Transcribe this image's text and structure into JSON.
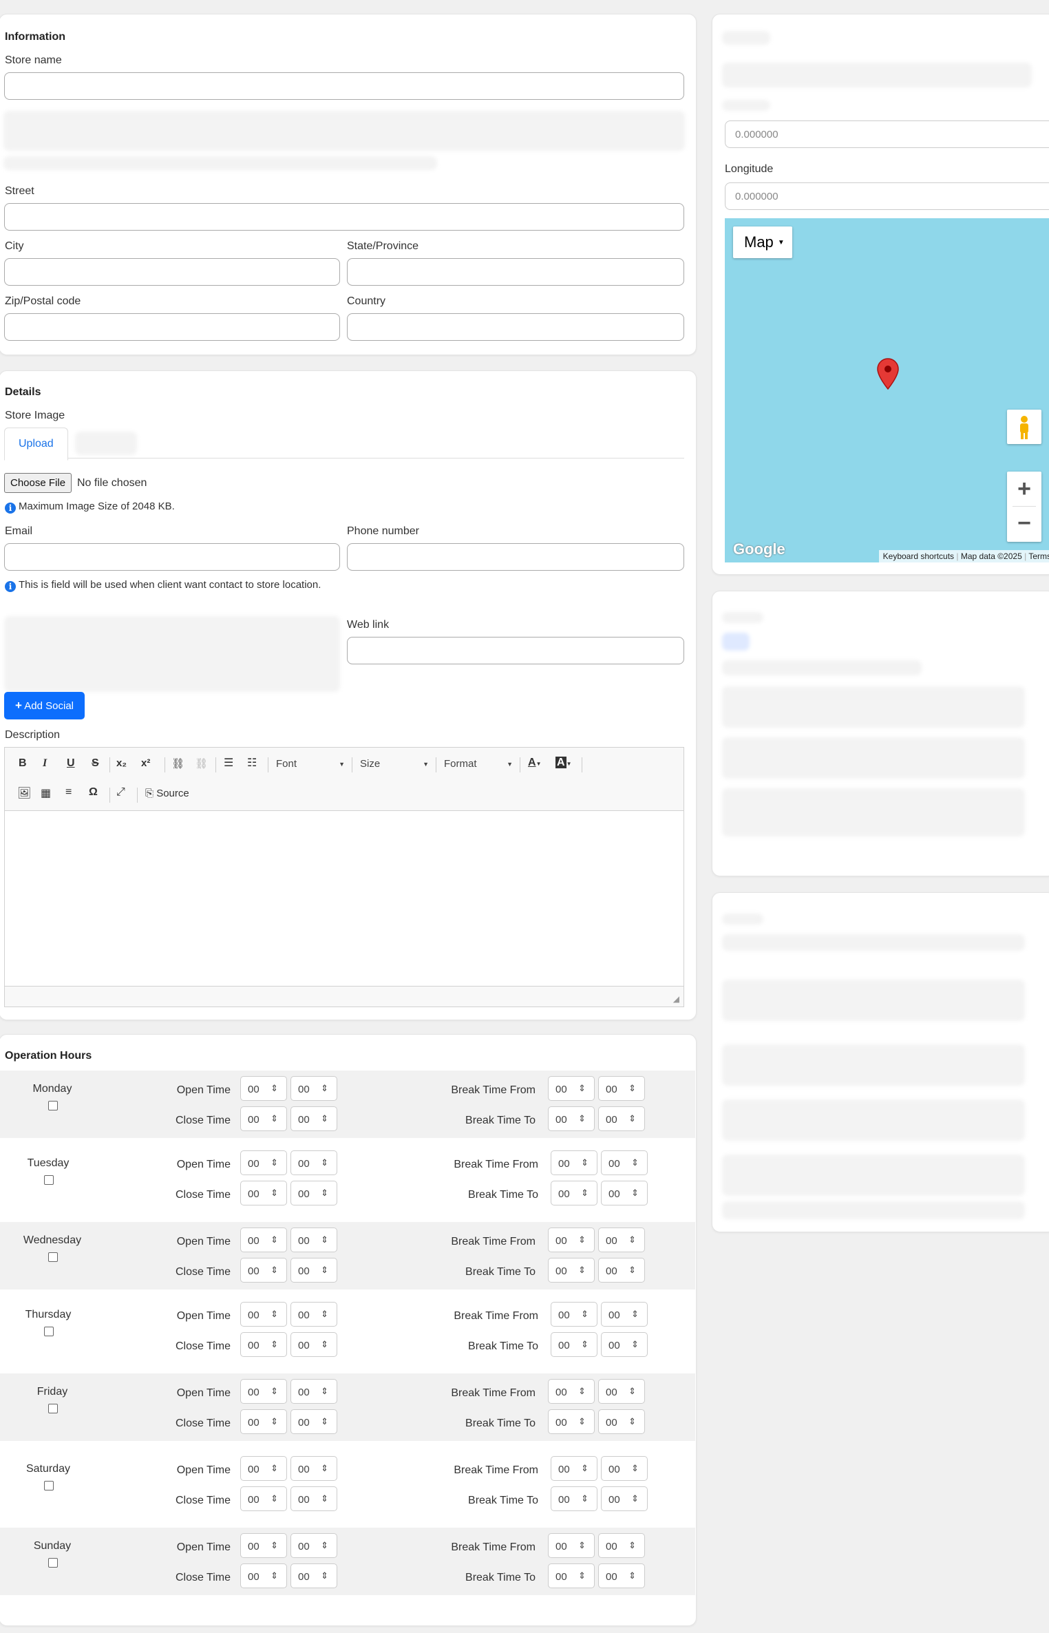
{
  "information": {
    "heading": "Information",
    "store_name_label": "Store name",
    "street_label": "Street",
    "city_label": "City",
    "state_label": "State/Province",
    "zip_label": "Zip/Postal code",
    "country_label": "Country"
  },
  "location": {
    "latitude_value": "0.000000",
    "longitude_label": "Longitude",
    "longitude_value": "0.000000",
    "map_type_label": "Map",
    "google_logo": "Google",
    "keyboard_shortcuts": "Keyboard shortcuts",
    "map_data": "Map data ©2025",
    "terms": "Terms",
    "zoom_in": "+",
    "zoom_out": "−"
  },
  "details": {
    "heading": "Details",
    "store_image_label": "Store Image",
    "upload_tab": "Upload",
    "choose_file": "Choose File",
    "no_file": "No file chosen",
    "max_image_note": "Maximum Image Size of 2048 KB.",
    "email_label": "Email",
    "phone_label": "Phone number",
    "email_note": "This is field will be used when client want contact to store location.",
    "web_link_label": "Web link",
    "add_social": "Add Social",
    "description_label": "Description"
  },
  "editor": {
    "bold": "B",
    "italic": "I",
    "underline": "U",
    "strike": "S",
    "subscript": "x₂",
    "superscript": "x²",
    "font": "Font",
    "size": "Size",
    "format": "Format",
    "text_color": "A",
    "bg_color": "A",
    "special_char": "Ω",
    "source": "Source"
  },
  "hours": {
    "heading": "Operation Hours",
    "open_label": "Open Time",
    "close_label": "Close Time",
    "break_from_label": "Break Time From",
    "break_to_label": "Break Time To",
    "default_value": "00",
    "days": [
      "Monday",
      "Tuesday",
      "Wednesday",
      "Thursday",
      "Friday",
      "Saturday",
      "Sunday"
    ]
  },
  "colors": {
    "primary": "#0d6efd",
    "map_water": "#8fd7ea",
    "pin": "#e53935"
  },
  "icons": [
    "info-icon",
    "plus-icon",
    "map-pin-icon",
    "pegman-icon",
    "resize-handle-icon"
  ]
}
